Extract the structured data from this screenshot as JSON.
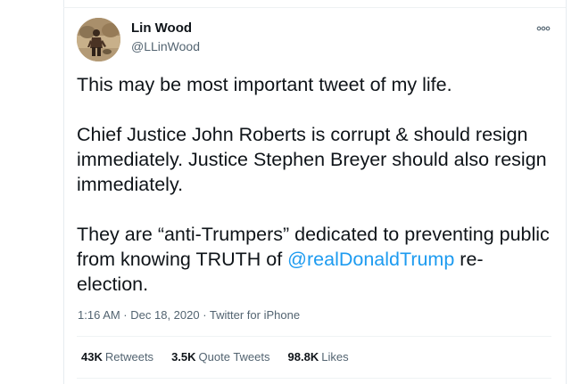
{
  "tweet": {
    "author_name": "Lin Wood",
    "author_handle": "@LLinWood",
    "paragraph_1": "This may be most important tweet of my life.",
    "paragraph_2": "Chief Justice John Roberts is corrupt & should resign immediately. Justice Stephen Breyer should also resign immediately.",
    "paragraph_3_start": "They are “anti-Trumpers” dedicated to preventing public from knowing TRUTH of ",
    "mention": "@realDonaldTrump",
    "paragraph_3_end": " re-election.",
    "timestamp": "1:16 AM · Dec 18, 2020 · Twitter for iPhone"
  },
  "stats": {
    "retweets_count": "43K",
    "retweets_label": "Retweets",
    "quotes_count": "3.5K",
    "quotes_label": "Quote Tweets",
    "likes_count": "98.8K",
    "likes_label": "Likes"
  },
  "icons": {
    "more": "more-options-icon"
  },
  "colors": {
    "link": "#1d9bf0",
    "text": "#0f1419",
    "secondary": "#536471"
  }
}
